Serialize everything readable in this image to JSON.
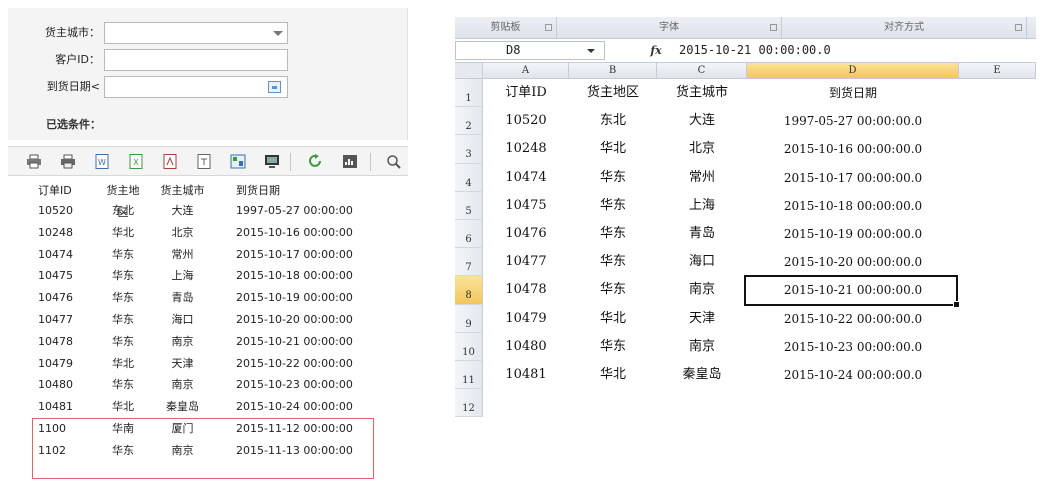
{
  "query_form": {
    "city_label": "货主城市：",
    "customer_label": "客户ID：",
    "date_label": "到货日期<",
    "city_value": "",
    "customer_value": "",
    "date_value": "",
    "selected_label": "已选条件："
  },
  "toolbar": {
    "buttons": [
      "print-icon",
      "print-preview-icon",
      "export-word-icon",
      "export-excel-icon",
      "export-pdf-icon",
      "export-text-icon",
      "export-image-icon",
      "screen-icon",
      "refresh-icon",
      "report-icon",
      "zoom-icon"
    ]
  },
  "report": {
    "headers": [
      "订单ID",
      "货主地区",
      "货主城市",
      "到货日期"
    ],
    "rows": [
      [
        "10520",
        "东北",
        "大连",
        "1997-05-27 00:00:00"
      ],
      [
        "10248",
        "华北",
        "北京",
        "2015-10-16 00:00:00"
      ],
      [
        "10474",
        "华东",
        "常州",
        "2015-10-17 00:00:00"
      ],
      [
        "10475",
        "华东",
        "上海",
        "2015-10-18 00:00:00"
      ],
      [
        "10476",
        "华东",
        "青岛",
        "2015-10-19 00:00:00"
      ],
      [
        "10477",
        "华东",
        "海口",
        "2015-10-20 00:00:00"
      ],
      [
        "10478",
        "华东",
        "南京",
        "2015-10-21 00:00:00"
      ],
      [
        "10479",
        "华北",
        "天津",
        "2015-10-22 00:00:00"
      ],
      [
        "10480",
        "华东",
        "南京",
        "2015-10-23 00:00:00"
      ],
      [
        "10481",
        "华北",
        "秦皇岛",
        "2015-10-24 00:00:00"
      ],
      [
        "1100",
        "华南",
        "厦门",
        "2015-11-12 00:00:00"
      ],
      [
        "1102",
        "华东",
        "南京",
        "2015-11-13 00:00:00"
      ]
    ]
  },
  "excel": {
    "ribbon_groups": [
      "剪贴板",
      "字体",
      "对齐方式"
    ],
    "name_box": "D8",
    "fx": "fx",
    "formula": "2015-10-21  00:00:00.0",
    "columns": [
      "A",
      "B",
      "C",
      "D",
      "E"
    ],
    "active_column": "D",
    "active_row": "8",
    "row_numbers": [
      "1",
      "2",
      "3",
      "4",
      "5",
      "6",
      "7",
      "8",
      "9",
      "10",
      "11",
      "12"
    ],
    "rows": [
      [
        "订单ID",
        "货主地区",
        "货主城市",
        "到货日期"
      ],
      [
        "10520",
        "东北",
        "大连",
        "1997-05-27 00:00:00.0"
      ],
      [
        "10248",
        "华北",
        "北京",
        "2015-10-16 00:00:00.0"
      ],
      [
        "10474",
        "华东",
        "常州",
        "2015-10-17 00:00:00.0"
      ],
      [
        "10475",
        "华东",
        "上海",
        "2015-10-18 00:00:00.0"
      ],
      [
        "10476",
        "华东",
        "青岛",
        "2015-10-19 00:00:00.0"
      ],
      [
        "10477",
        "华东",
        "海口",
        "2015-10-20 00:00:00.0"
      ],
      [
        "10478",
        "华东",
        "南京",
        "2015-10-21 00:00:00.0"
      ],
      [
        "10479",
        "华北",
        "天津",
        "2015-10-22 00:00:00.0"
      ],
      [
        "10480",
        "华东",
        "南京",
        "2015-10-23 00:00:00.0"
      ],
      [
        "10481",
        "华北",
        "秦皇岛",
        "2015-10-24 00:00:00.0"
      ]
    ]
  },
  "colors": {
    "highlight_box": "#e06666",
    "active_header": "#f3c65c",
    "icon_blue": "#3a6fb0",
    "icon_green": "#3a9a3a"
  }
}
